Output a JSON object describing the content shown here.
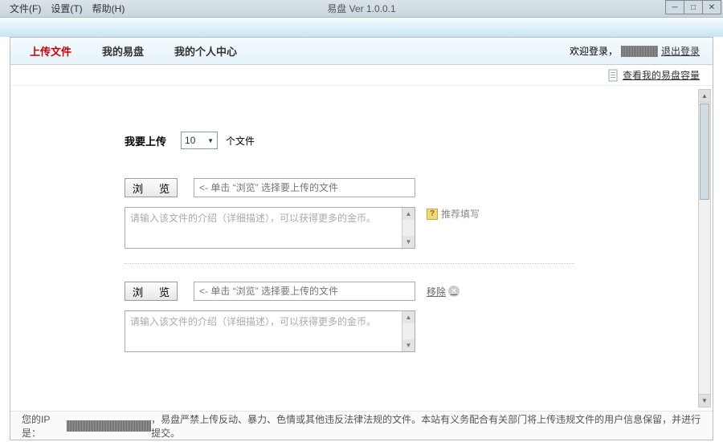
{
  "titlebar": {
    "menus": {
      "file": "文件(F)",
      "settings": "设置(T)",
      "help": "帮助(H)"
    },
    "app_title": "易盘 Ver 1.0.0.1"
  },
  "tabs": {
    "upload": "上传文件",
    "mydisk": "我的易盘",
    "profile": "我的个人中心"
  },
  "login": {
    "welcome": "欢迎登录，",
    "logout": "退出登录"
  },
  "capacity_link": "查看我的易盘容量",
  "upload": {
    "prefix": "我要上传",
    "count": "10",
    "suffix": "个文件",
    "browse": "浏 览",
    "file_placeholder": "<- 单击 “浏览” 选择要上传的文件",
    "desc_placeholder": "请输入该文件的介绍（详细描述），可以获得更多的金币。",
    "hint": "推荐填写",
    "remove": "移除"
  },
  "footer": {
    "ip_prefix": "您的IP是：",
    "warning": "，易盘严禁上传反动、暴力、色情或其他违反法律法规的文件。本站有义务配合有关部门将上传违规文件的用户信息保留，并进行提交。"
  }
}
